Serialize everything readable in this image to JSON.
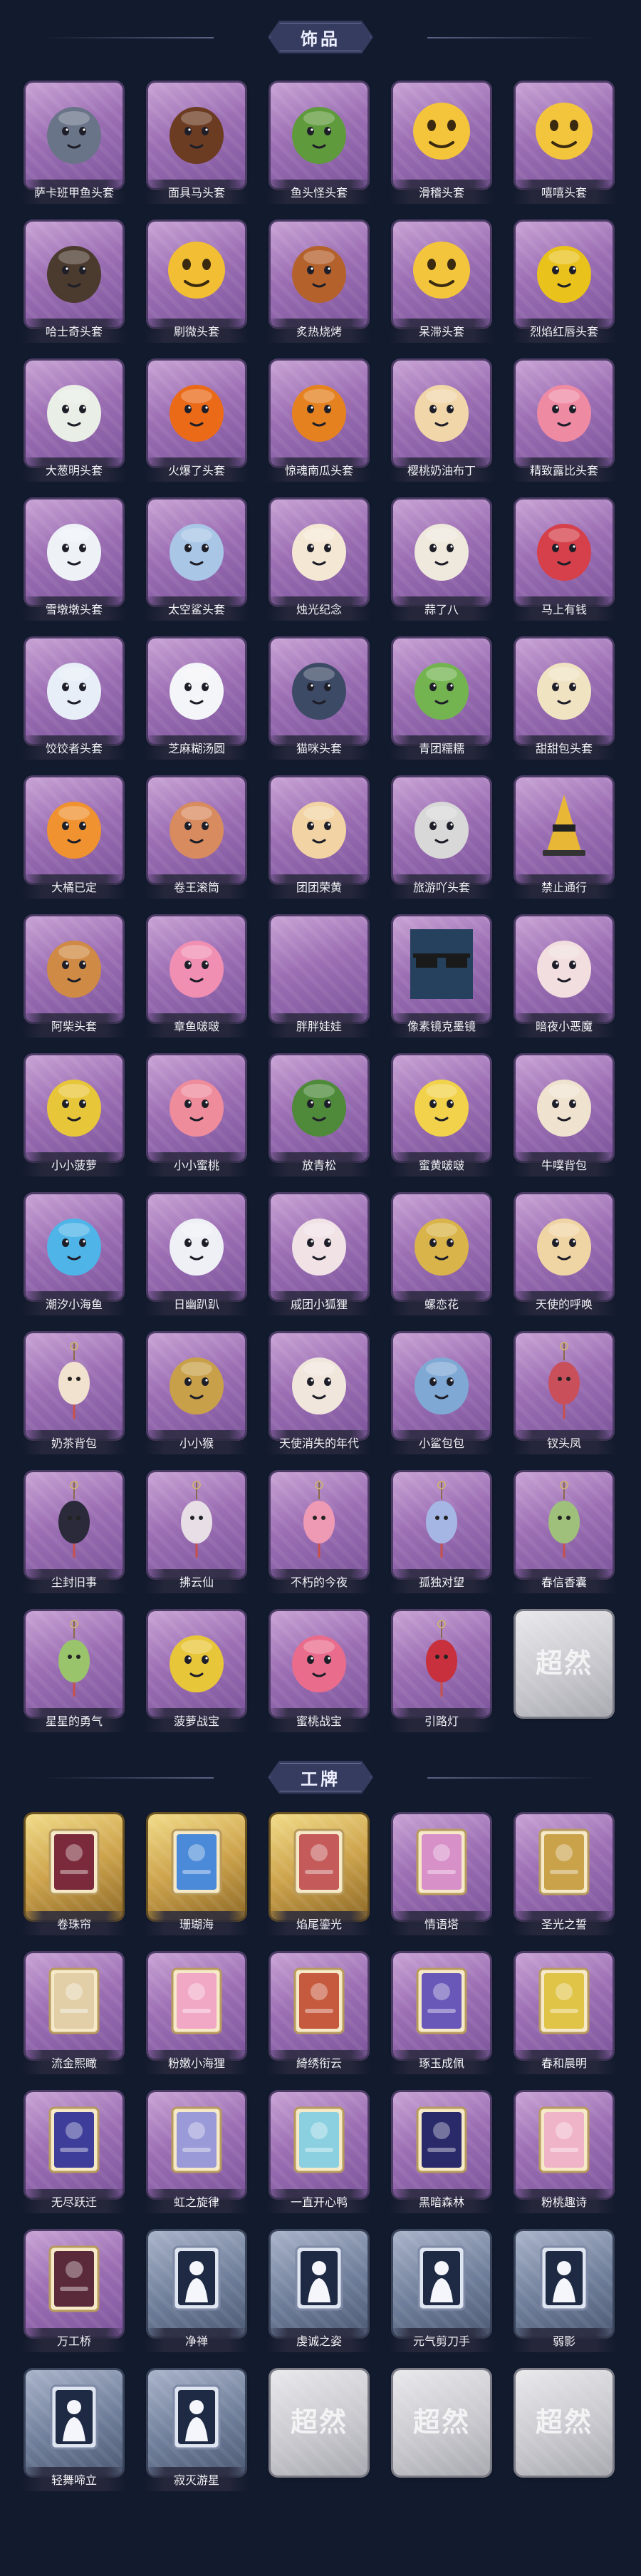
{
  "accessories": {
    "header": "饰品",
    "items": [
      {
        "label": "萨卡班甲鱼头套",
        "icon": "fish-head-icon",
        "color": "#6a7488"
      },
      {
        "label": "面具马头套",
        "icon": "horse-head-icon",
        "color": "#6b3b22"
      },
      {
        "label": "鱼头怪头套",
        "icon": "green-fish-icon",
        "color": "#5f9a3c"
      },
      {
        "label": "滑稽头套",
        "icon": "smirk-emoji-icon",
        "color": "#f4c43a"
      },
      {
        "label": "嘻嘻头套",
        "icon": "grin-emoji-icon",
        "color": "#f3c53c"
      },
      {
        "label": "哈士奇头套",
        "icon": "husky-head-icon",
        "color": "#4b3a2e"
      },
      {
        "label": "刷微头套",
        "icon": "smile-emoji-icon",
        "color": "#f2be33"
      },
      {
        "label": "炙热烧烤",
        "icon": "grill-creature-icon",
        "color": "#b4612c"
      },
      {
        "label": "呆滞头套",
        "icon": "dazed-emoji-icon",
        "color": "#f3c53c"
      },
      {
        "label": "烈焰红唇头套",
        "icon": "yellow-mascot-icon",
        "color": "#e9c21c"
      },
      {
        "label": "大葱明头套",
        "icon": "scallion-icon",
        "color": "#e9eee6"
      },
      {
        "label": "火爆了头套",
        "icon": "flame-icon",
        "color": "#ea6a18"
      },
      {
        "label": "惊魂南瓜头套",
        "icon": "pumpkin-icon",
        "color": "#e5811f"
      },
      {
        "label": "樱桃奶油布丁",
        "icon": "pudding-icon",
        "color": "#f0d6a8"
      },
      {
        "label": "精致露比头套",
        "icon": "pink-bird-icon",
        "color": "#ef8aa3"
      },
      {
        "label": "雪墩墩头套",
        "icon": "snowman-icon",
        "color": "#eef2f7"
      },
      {
        "label": "太空鲨头套",
        "icon": "shark-icon",
        "color": "#a9c6e6"
      },
      {
        "label": "烛光纪念",
        "icon": "candle-icon",
        "color": "#f4e8d4"
      },
      {
        "label": "蒜了八",
        "icon": "garlic-icon",
        "color": "#efe8dc"
      },
      {
        "label": "马上有钱",
        "icon": "red-horse-icon",
        "color": "#d5404a"
      },
      {
        "label": "饺饺者头套",
        "icon": "cloud-creature-icon",
        "color": "#e7eef7"
      },
      {
        "label": "芝麻糊汤圆",
        "icon": "dumpling-icon",
        "color": "#f4f5f8"
      },
      {
        "label": "猫咪头套",
        "icon": "cat-head-icon",
        "color": "#3d4a66"
      },
      {
        "label": "青团糯糯",
        "icon": "green-bun-icon",
        "color": "#73b451"
      },
      {
        "label": "甜甜包头套",
        "icon": "bun-icon",
        "color": "#efe3c2"
      },
      {
        "label": "大橘已定",
        "icon": "orange-slice-icon",
        "color": "#f09230"
      },
      {
        "label": "卷王滚筒",
        "icon": "swiss-roll-icon",
        "color": "#d88b5f"
      },
      {
        "label": "团团荣黄",
        "icon": "hamster-icon",
        "color": "#f2d3a3"
      },
      {
        "label": "旅游吖头套",
        "icon": "traveler-icon",
        "color": "#d8d8d8"
      },
      {
        "label": "禁止通行",
        "icon": "traffic-cone-icon",
        "color": "#e9b736"
      },
      {
        "label": "阿柴头套",
        "icon": "shiba-icon",
        "color": "#cf8a45"
      },
      {
        "label": "章鱼啵啵",
        "icon": "octopus-icon",
        "color": "#f08fb2"
      },
      {
        "label": "胖胖娃娃",
        "icon": "blank-icon",
        "color": "#b38dc4"
      },
      {
        "label": "像素镜克墨镜",
        "icon": "pixel-sunglasses-icon",
        "color": "#1a1a1a"
      },
      {
        "label": "暗夜小恶魔",
        "icon": "devil-girl-icon",
        "color": "#f2dede"
      },
      {
        "label": "小小菠萝",
        "icon": "pineapple-icon",
        "color": "#e8c63a"
      },
      {
        "label": "小小蜜桃",
        "icon": "peach-icon",
        "color": "#ef8c9c"
      },
      {
        "label": "放青松",
        "icon": "bonsai-icon",
        "color": "#4e8a3a"
      },
      {
        "label": "蜜黄啵啵",
        "icon": "yellow-chick-icon",
        "color": "#f2d24a"
      },
      {
        "label": "牛噗背包",
        "icon": "cow-backpack-icon",
        "color": "#efe3cf"
      },
      {
        "label": "潮汐小海鱼",
        "icon": "blue-creature-icon",
        "color": "#4fb4e8"
      },
      {
        "label": "日幽趴趴",
        "icon": "white-figure-icon",
        "color": "#eef0f6"
      },
      {
        "label": "戚团小狐狸",
        "icon": "fox-icon",
        "color": "#f1e2e6"
      },
      {
        "label": "螺恋花",
        "icon": "flower-wreath-icon",
        "color": "#d9b44a"
      },
      {
        "label": "天使的呼唤",
        "icon": "angel-icon",
        "color": "#f0d5a4"
      },
      {
        "label": "奶茶背包",
        "icon": "milk-tea-icon",
        "color": "#f1e1cf"
      },
      {
        "label": "小小猴",
        "icon": "monkey-icon",
        "color": "#c9a04a"
      },
      {
        "label": "天使消失的年代",
        "icon": "angel-girl-icon",
        "color": "#f0e6dc"
      },
      {
        "label": "小鲨包包",
        "icon": "shark-bag-icon",
        "color": "#7fa9d4"
      },
      {
        "label": "钗头凤",
        "icon": "phoenix-pendant-icon",
        "color": "#c9505a"
      },
      {
        "label": "尘封旧事",
        "icon": "keychain-boy-icon",
        "color": "#2a2a3a"
      },
      {
        "label": "拂云仙",
        "icon": "keychain-fairy-icon",
        "color": "#e8dfe6"
      },
      {
        "label": "不朽的今夜",
        "icon": "keychain-pink-icon",
        "color": "#ee9ab4"
      },
      {
        "label": "孤独对望",
        "icon": "keychain-blue-icon",
        "color": "#a6b6e4"
      },
      {
        "label": "春信香囊",
        "icon": "sachet-icon",
        "color": "#9fc07a"
      },
      {
        "label": "星星的勇气",
        "icon": "keychain-green-icon",
        "color": "#9ac46c"
      },
      {
        "label": "菠萝战宝",
        "icon": "pineapple-warrior-icon",
        "color": "#e8c63a"
      },
      {
        "label": "蜜桃战宝",
        "icon": "peach-warrior-icon",
        "color": "#e96c8c"
      },
      {
        "label": "引路灯",
        "icon": "lantern-icon",
        "color": "#c7303c"
      },
      {
        "label": "",
        "icon": "placeholder-logo-icon",
        "color": "#ffffff",
        "placeholder": "超然"
      }
    ]
  },
  "badges": {
    "header": "工牌",
    "items": [
      {
        "label": "卷珠帘",
        "icon": "badge-card-icon",
        "color": "#7a2a3a",
        "frame": "gold"
      },
      {
        "label": "珊瑚海",
        "icon": "badge-card-icon",
        "color": "#4a8ad8",
        "frame": "gold"
      },
      {
        "label": "焰尾鎏光",
        "icon": "badge-card-icon",
        "color": "#c45a5a",
        "frame": "gold"
      },
      {
        "label": "情语塔",
        "icon": "badge-card-icon",
        "color": "#d890c8",
        "frame": "purple"
      },
      {
        "label": "圣光之誓",
        "icon": "badge-card-icon",
        "color": "#c9a24a",
        "frame": "purple"
      },
      {
        "label": "流金熙瞰",
        "icon": "badge-card-icon",
        "color": "#e2cfa8",
        "frame": "purple"
      },
      {
        "label": "粉嫩小海狸",
        "icon": "badge-card-icon",
        "color": "#f0a8c4",
        "frame": "purple"
      },
      {
        "label": "綺绣衔云",
        "icon": "badge-card-icon",
        "color": "#c65a3e",
        "frame": "purple"
      },
      {
        "label": "琢玉成佩",
        "icon": "badge-card-icon",
        "color": "#6a58b8",
        "frame": "purple"
      },
      {
        "label": "春和晨明",
        "icon": "badge-card-icon",
        "color": "#e0c448",
        "frame": "purple"
      },
      {
        "label": "无尽跃迁",
        "icon": "badge-card-icon",
        "color": "#3e3e9a",
        "frame": "purple"
      },
      {
        "label": "虹之旋律",
        "icon": "badge-card-icon",
        "color": "#9a9ad8",
        "frame": "purple"
      },
      {
        "label": "一直开心鸭",
        "icon": "badge-card-icon",
        "color": "#8ad0e0",
        "frame": "purple"
      },
      {
        "label": "黑暗森林",
        "icon": "badge-card-icon",
        "color": "#2a2a6a",
        "frame": "purple"
      },
      {
        "label": "粉桃趣诗",
        "icon": "badge-card-icon",
        "color": "#f0b4c8",
        "frame": "purple"
      },
      {
        "label": "万工桥",
        "icon": "badge-card-icon",
        "color": "#5a2a3a",
        "frame": "purple"
      },
      {
        "label": "净禅",
        "icon": "silhouette-icon",
        "color": "#1e2a44",
        "frame": "blue"
      },
      {
        "label": "虔诚之姿",
        "icon": "silhouette-icon",
        "color": "#1e2a44",
        "frame": "blue"
      },
      {
        "label": "元气剪刀手",
        "icon": "silhouette-icon",
        "color": "#1e2a44",
        "frame": "blue"
      },
      {
        "label": "弱影",
        "icon": "silhouette-icon",
        "color": "#1e2a44",
        "frame": "blue"
      },
      {
        "label": "轻舞啼立",
        "icon": "silhouette-icon",
        "color": "#1e2a44",
        "frame": "blue"
      },
      {
        "label": "寂灭游星",
        "icon": "silhouette-icon",
        "color": "#1e2a44",
        "frame": "blue"
      },
      {
        "label": "",
        "icon": "placeholder-logo-icon",
        "color": "#ffffff",
        "frame": "grey",
        "placeholder": "超然"
      },
      {
        "label": "",
        "icon": "placeholder-logo-icon",
        "color": "#ffffff",
        "frame": "grey",
        "placeholder": "超然"
      },
      {
        "label": "",
        "icon": "placeholder-logo-icon",
        "color": "#ffffff",
        "frame": "grey",
        "placeholder": "超然"
      }
    ]
  }
}
